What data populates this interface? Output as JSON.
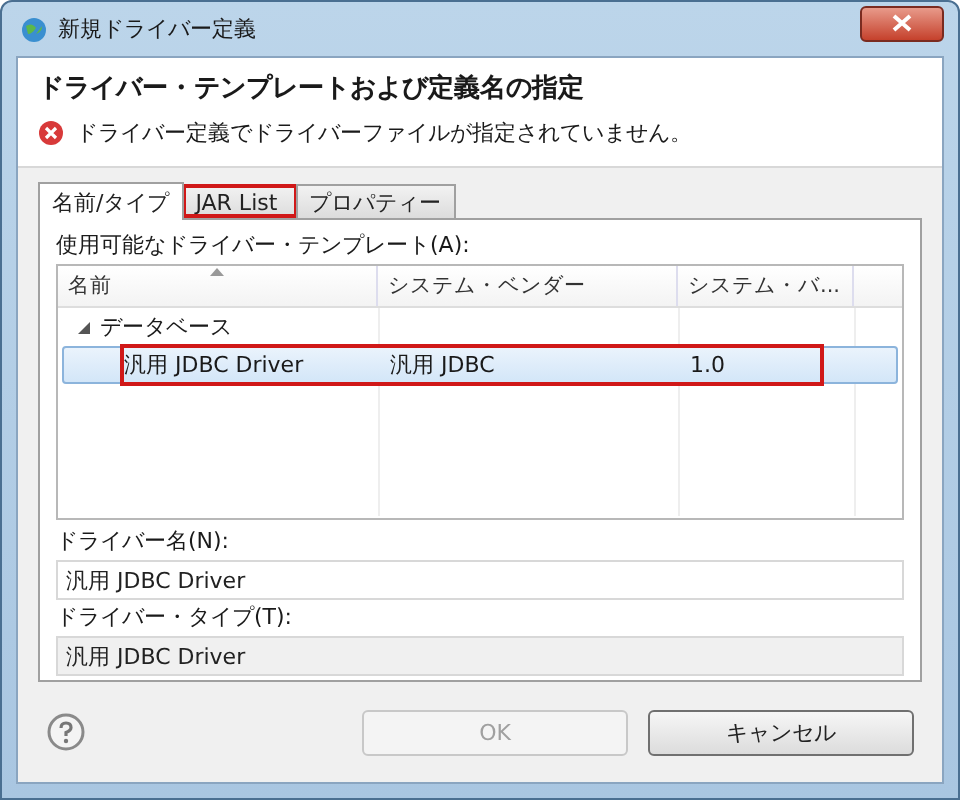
{
  "window": {
    "title": "新規ドライバー定義"
  },
  "header": {
    "title": "ドライバー・テンプレートおよび定義名の指定",
    "error": "ドライバー定義でドライバーファイルが指定されていません。"
  },
  "tabs": [
    {
      "label": "名前/タイプ",
      "selected": true,
      "highlighted": false
    },
    {
      "label": "JAR List",
      "selected": false,
      "highlighted": true
    },
    {
      "label": "プロパティー",
      "selected": false,
      "highlighted": false
    }
  ],
  "templates_label": "使用可能なドライバー・テンプレート(A):",
  "table": {
    "columns": [
      "名前",
      "システム・ベンダー",
      "システム・バ..."
    ],
    "rows": [
      {
        "label": "データベース",
        "expanded": true,
        "children": [
          {
            "cells": [
              "汎用 JDBC Driver",
              "汎用 JDBC",
              "1.0"
            ],
            "selected": true,
            "highlighted": true
          }
        ]
      }
    ]
  },
  "driver_name": {
    "label": "ドライバー名(N):",
    "value": "汎用 JDBC Driver"
  },
  "driver_type": {
    "label": "ドライバー・タイプ(T):",
    "value": "汎用 JDBC Driver"
  },
  "buttons": [
    {
      "label": "OK",
      "disabled": true
    },
    {
      "label": "キャンセル",
      "disabled": false
    }
  ]
}
